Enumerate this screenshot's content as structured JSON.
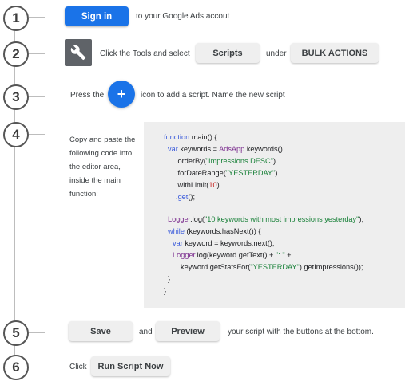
{
  "steps": [
    "1",
    "2",
    "3",
    "4",
    "5",
    "6"
  ],
  "step1": {
    "button": "Sign in",
    "text": "to your Google Ads accout"
  },
  "step2": {
    "icon": "wrench-icon",
    "text_before": "Click the Tools and select",
    "scripts_button": "Scripts",
    "text_mid": "under",
    "bulk_button": "BULK ACTIONS"
  },
  "step3": {
    "text_before": "Press the",
    "icon": "plus-icon",
    "text_after": "icon to add a script. Name the new script"
  },
  "step4": {
    "lines": [
      "Copy and paste the",
      "following code into",
      "the editor area,",
      "inside the main",
      "function:"
    ]
  },
  "code": {
    "l1_kw": "function",
    "l1_rest": " main() {",
    "l2_kw": "var",
    "l2_mid": " keywords = ",
    "l2_obj": "AdsApp",
    "l2_rest": ".keywords()",
    "l3_a": ".orderBy(",
    "l3_str": "\"Impressions DESC\"",
    "l3_b": ")",
    "l4_a": ".forDateRange(",
    "l4_str": "\"YESTERDAY\"",
    "l4_b": ")",
    "l5_a": ".withLimit(",
    "l5_num": "10",
    "l5_b": ")",
    "l6_a": ".",
    "l6_kw": "get",
    "l6_b": "();",
    "l7_obj": "Logger",
    "l7_a": ".log(",
    "l7_str": "\"10 keywords with most impressions yesterday\"",
    "l7_b": ");",
    "l8_kw": "while",
    "l8_rest": " (keywords.hasNext()) {",
    "l9_kw": "var",
    "l9_rest": " keyword = keywords.next();",
    "l10_obj": "Logger",
    "l10_a": ".log(keyword.getText() + ",
    "l10_str": "\": \"",
    "l10_b": " +",
    "l11_a": "keyword.getStatsFor(",
    "l11_str": "\"YESTERDAY\"",
    "l11_b": ").getImpressions());",
    "l12": "}",
    "l13": "}"
  },
  "step5": {
    "save_button": "Save",
    "and": "and",
    "preview_button": "Preview",
    "text": "your script with the buttons at the bottom."
  },
  "step6": {
    "text": "Click",
    "run_button": "Run Script Now"
  }
}
